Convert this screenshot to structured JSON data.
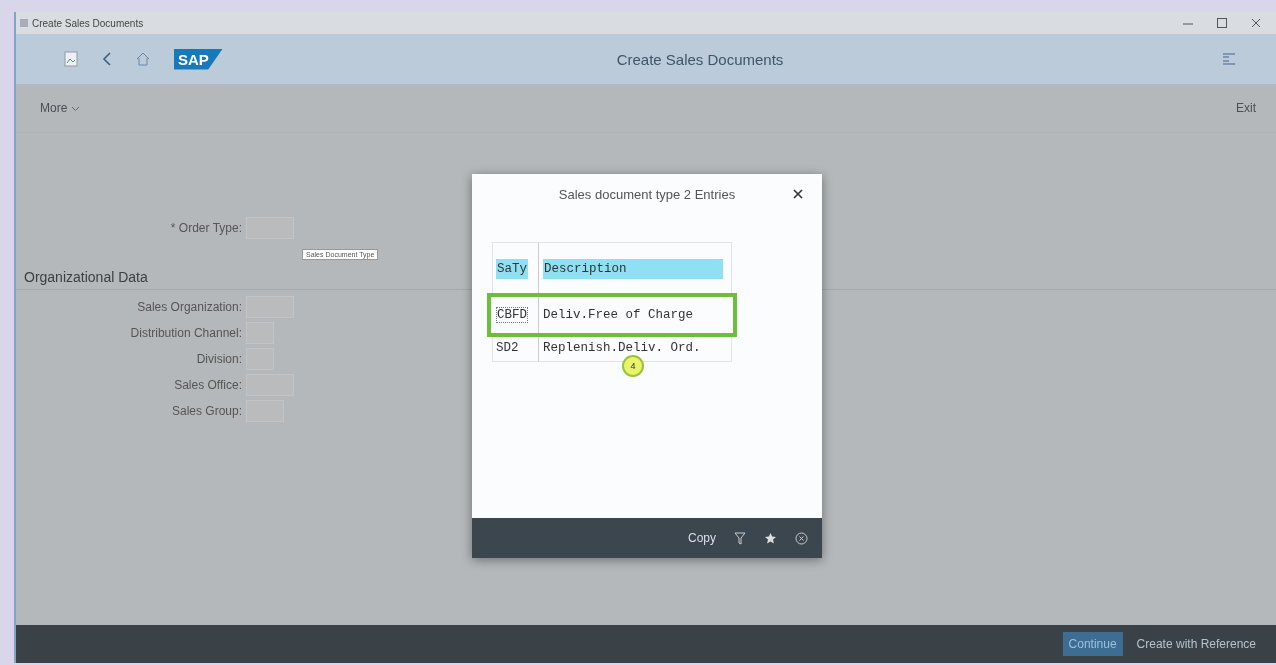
{
  "window": {
    "title": "Create Sales Documents"
  },
  "shell": {
    "title": "Create Sales Documents",
    "logo": "SAP"
  },
  "toolbar": {
    "more": "More",
    "exit": "Exit"
  },
  "form": {
    "order_type": {
      "label": "* Order Type:",
      "tooltip": "Sales Document Type"
    },
    "section": "Organizational Data",
    "fields": [
      {
        "label": "Sales Organization:"
      },
      {
        "label": "Distribution Channel:"
      },
      {
        "label": "Division:"
      },
      {
        "label": "Sales Office:"
      },
      {
        "label": "Sales Group:"
      }
    ]
  },
  "dialog": {
    "title": "Sales document type 2 Entries",
    "columns": [
      "SaTy",
      "Description"
    ],
    "rows": [
      {
        "code": "CBFD",
        "description": "Deliv.Free of Charge",
        "selected": true
      },
      {
        "code": "SD2",
        "description": "Replenish.Deliv. Ord.",
        "selected": false
      }
    ],
    "step_marker": "4",
    "footer": {
      "copy": "Copy"
    }
  },
  "footer": {
    "buttons": [
      {
        "label": "Continue",
        "kind": "emphasized"
      },
      {
        "label": "Create with Reference",
        "kind": "plain"
      }
    ]
  }
}
